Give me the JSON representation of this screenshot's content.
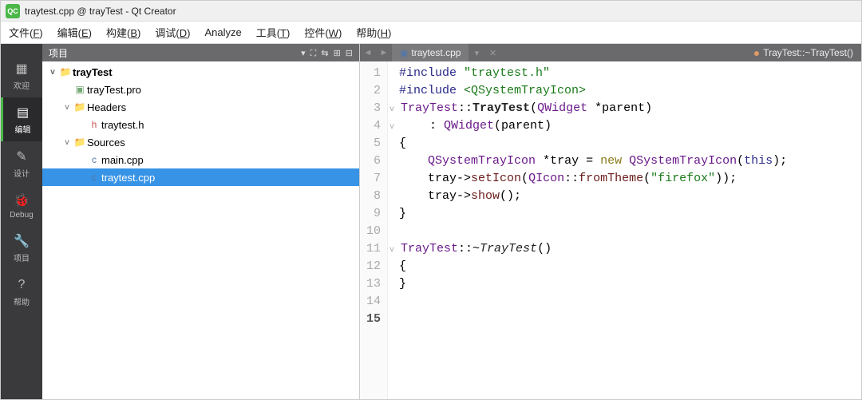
{
  "window": {
    "title": "traytest.cpp @ trayTest - Qt Creator",
    "icon_label": "QC"
  },
  "menubar": [
    {
      "label": "文件",
      "key": "F"
    },
    {
      "label": "编辑",
      "key": "E"
    },
    {
      "label": "构建",
      "key": "B"
    },
    {
      "label": "调试",
      "key": "D"
    },
    {
      "label": "Analyze",
      "key": ""
    },
    {
      "label": "工具",
      "key": "T"
    },
    {
      "label": "控件",
      "key": "W"
    },
    {
      "label": "帮助",
      "key": "H"
    }
  ],
  "modes": [
    {
      "label": "欢迎",
      "icon": "▦",
      "active": false
    },
    {
      "label": "编辑",
      "icon": "▤",
      "active": true
    },
    {
      "label": "设计",
      "icon": "✎",
      "active": false
    },
    {
      "label": "Debug",
      "icon": "🐞",
      "active": false
    },
    {
      "label": "项目",
      "icon": "🔧",
      "active": false
    },
    {
      "label": "帮助",
      "icon": "?",
      "active": false
    }
  ],
  "sidebar": {
    "title": "项目",
    "tools": [
      "▾",
      "⛶",
      "⇆",
      "⊞",
      "⊟"
    ],
    "tree": [
      {
        "depth": 0,
        "caret": "v",
        "icon": "📁",
        "iclass": "folder-ic",
        "label": "trayTest",
        "sel": false
      },
      {
        "depth": 1,
        "caret": "",
        "icon": "▣",
        "iclass": "proj-ic",
        "label": "trayTest.pro",
        "sel": false
      },
      {
        "depth": 1,
        "caret": "v",
        "icon": "📁",
        "iclass": "folder-ic",
        "label": "Headers",
        "sel": false
      },
      {
        "depth": 2,
        "caret": "",
        "icon": "h",
        "iclass": "h-ic",
        "label": "traytest.h",
        "sel": false
      },
      {
        "depth": 1,
        "caret": "v",
        "icon": "📁",
        "iclass": "folder-ic",
        "label": "Sources",
        "sel": false
      },
      {
        "depth": 2,
        "caret": "",
        "icon": "c",
        "iclass": "cpp-ic",
        "label": "main.cpp",
        "sel": false
      },
      {
        "depth": 2,
        "caret": "",
        "icon": "c",
        "iclass": "cpp-ic",
        "label": "traytest.cpp",
        "sel": true
      }
    ]
  },
  "editor": {
    "tab": {
      "label": "traytest.cpp"
    },
    "symbol": {
      "label": "TrayTest::~TrayTest()"
    },
    "current_line": 15,
    "lines": [
      {
        "n": 1,
        "fold": "",
        "tokens": [
          [
            "tok-pre",
            "#include "
          ],
          [
            "tok-str",
            "\"traytest.h\""
          ]
        ]
      },
      {
        "n": 2,
        "fold": "",
        "tokens": [
          [
            "tok-pre",
            "#include "
          ],
          [
            "tok-str",
            "<QSystemTrayIcon>"
          ]
        ]
      },
      {
        "n": 3,
        "fold": "v",
        "tokens": [
          [
            "tok-type",
            "TrayTest"
          ],
          [
            "",
            "::"
          ],
          [
            "tok-func",
            "TrayTest"
          ],
          [
            "",
            "("
          ],
          [
            "tok-type",
            "QWidget"
          ],
          [
            "",
            " *parent)"
          ]
        ]
      },
      {
        "n": 4,
        "fold": "v",
        "tokens": [
          [
            "",
            "    : "
          ],
          [
            "tok-type",
            "QWidget"
          ],
          [
            "",
            "(parent)"
          ]
        ]
      },
      {
        "n": 5,
        "fold": "",
        "tokens": [
          [
            "",
            "{"
          ]
        ]
      },
      {
        "n": 6,
        "fold": "",
        "tokens": [
          [
            "",
            "    "
          ],
          [
            "tok-type",
            "QSystemTrayIcon"
          ],
          [
            "",
            " *tray = "
          ],
          [
            "tok-kw",
            "new"
          ],
          [
            "",
            " "
          ],
          [
            "tok-type",
            "QSystemTrayIcon"
          ],
          [
            "",
            "("
          ],
          [
            "tok-this",
            "this"
          ],
          [
            "",
            ");"
          ]
        ]
      },
      {
        "n": 7,
        "fold": "",
        "tokens": [
          [
            "",
            "    tray->"
          ],
          [
            "tok-method",
            "setIcon"
          ],
          [
            "",
            "("
          ],
          [
            "tok-type",
            "QIcon"
          ],
          [
            "",
            "::"
          ],
          [
            "tok-method",
            "fromTheme"
          ],
          [
            "",
            "("
          ],
          [
            "tok-str",
            "\"firefox\""
          ],
          [
            "",
            "));"
          ]
        ]
      },
      {
        "n": 8,
        "fold": "",
        "tokens": [
          [
            "",
            "    tray->"
          ],
          [
            "tok-method",
            "show"
          ],
          [
            "",
            "();"
          ]
        ]
      },
      {
        "n": 9,
        "fold": "",
        "tokens": [
          [
            "",
            "}"
          ]
        ]
      },
      {
        "n": 10,
        "fold": "",
        "tokens": [
          [
            "",
            ""
          ]
        ]
      },
      {
        "n": 11,
        "fold": "v",
        "tokens": [
          [
            "tok-type",
            "TrayTest"
          ],
          [
            "",
            "::~"
          ],
          [
            "tok-italic",
            "TrayTest"
          ],
          [
            "",
            "()"
          ]
        ]
      },
      {
        "n": 12,
        "fold": "",
        "tokens": [
          [
            "",
            "{"
          ]
        ]
      },
      {
        "n": 13,
        "fold": "",
        "tokens": [
          [
            "",
            "}"
          ]
        ]
      },
      {
        "n": 14,
        "fold": "",
        "tokens": [
          [
            "",
            ""
          ]
        ]
      },
      {
        "n": 15,
        "fold": "",
        "tokens": [
          [
            "",
            ""
          ]
        ]
      }
    ]
  }
}
